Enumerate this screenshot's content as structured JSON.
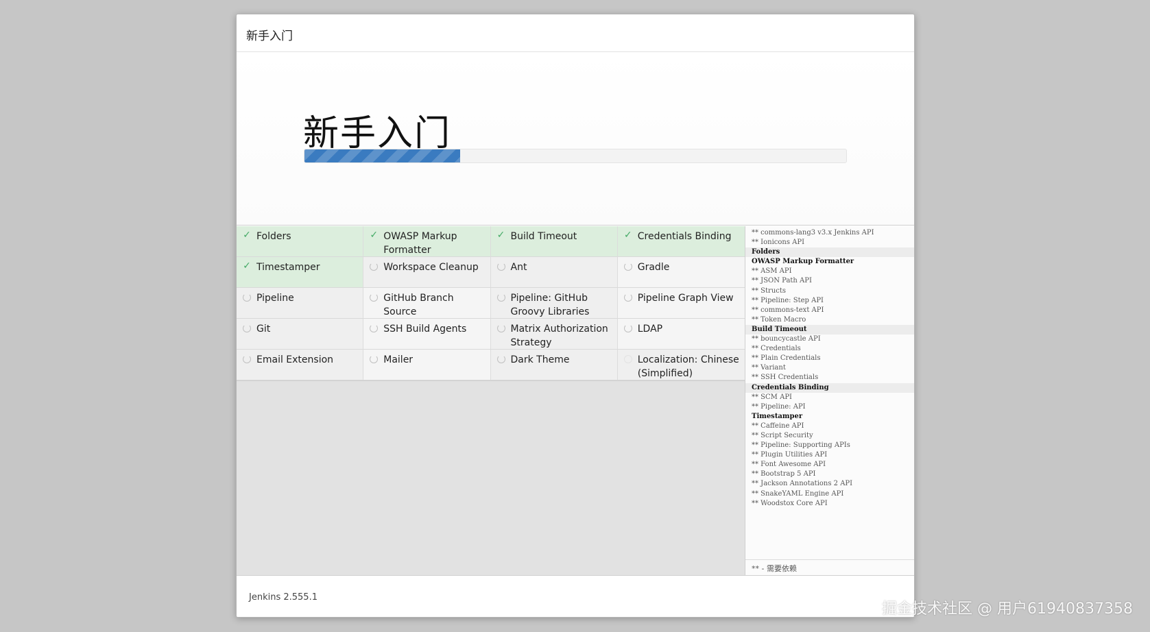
{
  "header": {
    "title": "新手入门"
  },
  "hero": {
    "title": "新手入门",
    "progress_percent": 28.7
  },
  "plugins": [
    {
      "name": "Folders",
      "status": "done"
    },
    {
      "name": "OWASP Markup Formatter",
      "status": "done"
    },
    {
      "name": "Build Timeout",
      "status": "done"
    },
    {
      "name": "Credentials Binding",
      "status": "done"
    },
    {
      "name": "Timestamper",
      "status": "done"
    },
    {
      "name": "Workspace Cleanup",
      "status": "pending"
    },
    {
      "name": "Ant",
      "status": "pending"
    },
    {
      "name": "Gradle",
      "status": "installing"
    },
    {
      "name": "Pipeline",
      "status": "pending"
    },
    {
      "name": "GitHub Branch Source",
      "status": "installing"
    },
    {
      "name": "Pipeline: GitHub Groovy Libraries",
      "status": "pending"
    },
    {
      "name": "Pipeline Graph View",
      "status": "installing"
    },
    {
      "name": "Git",
      "status": "pending"
    },
    {
      "name": "SSH Build Agents",
      "status": "installing"
    },
    {
      "name": "Matrix Authorization Strategy",
      "status": "pending"
    },
    {
      "name": "LDAP",
      "status": "installing"
    },
    {
      "name": "Email Extension",
      "status": "pending"
    },
    {
      "name": "Mailer",
      "status": "installing"
    },
    {
      "name": "Dark Theme",
      "status": "pending"
    },
    {
      "name": "Localization: Chinese (Simplified)",
      "status": "idle"
    }
  ],
  "log": [
    {
      "text": "** commons-lang3 v3.x Jenkins API",
      "kind": "dep"
    },
    {
      "text": "** Ionicons API",
      "kind": "dep"
    },
    {
      "text": "Folders",
      "kind": "plugin",
      "shaded": true
    },
    {
      "text": "OWASP Markup Formatter",
      "kind": "plugin"
    },
    {
      "text": "** ASM API",
      "kind": "dep"
    },
    {
      "text": "** JSON Path API",
      "kind": "dep"
    },
    {
      "text": "** Structs",
      "kind": "dep"
    },
    {
      "text": "** Pipeline: Step API",
      "kind": "dep"
    },
    {
      "text": "** commons-text API",
      "kind": "dep"
    },
    {
      "text": "** Token Macro",
      "kind": "dep"
    },
    {
      "text": "Build Timeout",
      "kind": "plugin",
      "shaded": true
    },
    {
      "text": "** bouncycastle API",
      "kind": "dep"
    },
    {
      "text": "** Credentials",
      "kind": "dep"
    },
    {
      "text": "** Plain Credentials",
      "kind": "dep"
    },
    {
      "text": "** Variant",
      "kind": "dep"
    },
    {
      "text": "** SSH Credentials",
      "kind": "dep"
    },
    {
      "text": "Credentials Binding",
      "kind": "plugin",
      "shaded": true
    },
    {
      "text": "** SCM API",
      "kind": "dep"
    },
    {
      "text": "** Pipeline: API",
      "kind": "dep"
    },
    {
      "text": "Timestamper",
      "kind": "plugin"
    },
    {
      "text": "** Caffeine API",
      "kind": "dep"
    },
    {
      "text": "** Script Security",
      "kind": "dep"
    },
    {
      "text": "** Pipeline: Supporting APIs",
      "kind": "dep"
    },
    {
      "text": "** Plugin Utilities API",
      "kind": "dep"
    },
    {
      "text": "** Font Awesome API",
      "kind": "dep"
    },
    {
      "text": "** Bootstrap 5 API",
      "kind": "dep"
    },
    {
      "text": "** Jackson Annotations 2 API",
      "kind": "dep"
    },
    {
      "text": "** SnakeYAML Engine API",
      "kind": "dep"
    },
    {
      "text": "** Woodstox Core API",
      "kind": "dep"
    }
  ],
  "log_footer": "** - 需要依赖",
  "footer": {
    "version": "Jenkins 2.555.1"
  },
  "watermark": "掘金技术社区 @ 用户61940837358",
  "icons": {
    "done": "check-icon",
    "pending": "spinner-icon",
    "installing": "spinner-icon",
    "idle": "spinner-idle-icon"
  },
  "colors": {
    "progress": "#3a7bc0",
    "done_bg": "#dceedd",
    "done_check": "#44aa66"
  }
}
